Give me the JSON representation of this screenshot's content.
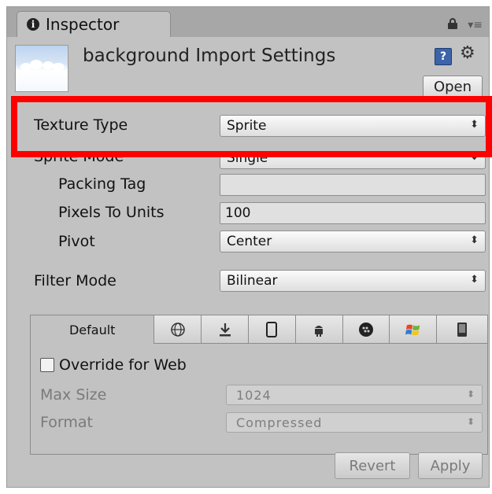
{
  "tab": {
    "title": "Inspector",
    "icon": "info-icon"
  },
  "header": {
    "title": "background Import Settings",
    "open_label": "Open",
    "help_label": "?"
  },
  "fields": {
    "texture_type": {
      "label": "Texture Type",
      "value": "Sprite"
    },
    "sprite_mode": {
      "label": "Sprite Mode",
      "value": "Single"
    },
    "packing_tag": {
      "label": "Packing Tag",
      "value": ""
    },
    "pixels_to_units": {
      "label": "Pixels To Units",
      "value": "100"
    },
    "pivot": {
      "label": "Pivot",
      "value": "Center"
    },
    "filter_mode": {
      "label": "Filter Mode",
      "value": "Bilinear"
    }
  },
  "platforms": {
    "tabs": [
      {
        "label": "Default",
        "icon": ""
      },
      {
        "label": "",
        "icon": "globe-icon"
      },
      {
        "label": "",
        "icon": "download-icon"
      },
      {
        "label": "",
        "icon": "phone-icon"
      },
      {
        "label": "",
        "icon": "android-icon"
      },
      {
        "label": "",
        "icon": "blackberry-icon"
      },
      {
        "label": "",
        "icon": "windows-icon"
      },
      {
        "label": "",
        "icon": "windows-phone-icon"
      }
    ],
    "override_label": "Override for Web",
    "max_size": {
      "label": "Max Size",
      "value": "1024"
    },
    "format": {
      "label": "Format",
      "value": "Compressed"
    }
  },
  "footer": {
    "revert_label": "Revert",
    "apply_label": "Apply"
  },
  "colors": {
    "highlight": "#ff0000",
    "panel": "#c2c2c2"
  }
}
